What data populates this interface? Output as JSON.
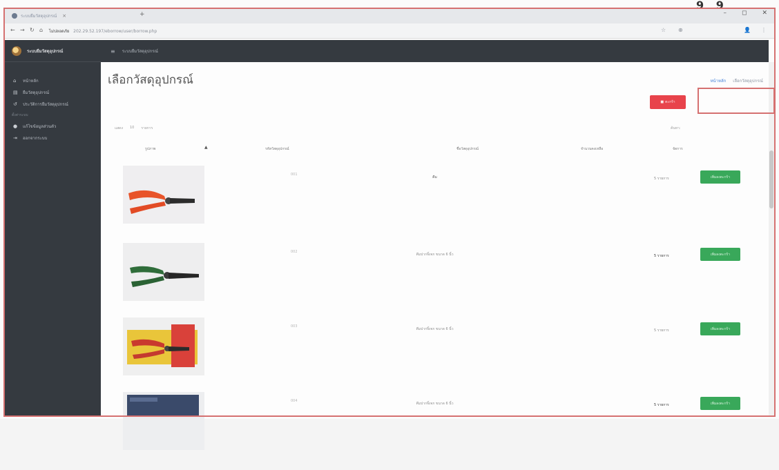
{
  "browser": {
    "tab_title": "ระบบยืมวัสดุอุปกรณ์",
    "tab_close": "×",
    "new_tab": "+",
    "window_controls": {
      "minimize": "–",
      "restore": "◻",
      "close": "✕"
    },
    "nav_icons": {
      "back": "←",
      "forward": "→",
      "reload": "↻",
      "home": "⌂"
    },
    "security_label": "ไม่ปลอดภัย",
    "url": "202.29.52.197/eborrow/user/borrow.php",
    "ext_icons": [
      "☆",
      "⊕",
      "⋮",
      "👤"
    ],
    "scan_marks": "9 9"
  },
  "sidebar": {
    "app_name": "ระบบยืมวัสดุอุปกรณ์",
    "items": [
      {
        "icon": "home-icon",
        "glyph": "⌂",
        "label": "หน้าหลัก"
      },
      {
        "icon": "list-icon",
        "glyph": "▤",
        "label": "ยืมวัสดุอุปกรณ์"
      },
      {
        "icon": "history-icon",
        "glyph": "↺",
        "label": "ประวัติการยืมวัสดุอุปกรณ์"
      }
    ],
    "heading": "ตั้งค่าระบบ",
    "items2": [
      {
        "icon": "user-icon",
        "glyph": "●",
        "label": "แก้ไขข้อมูลส่วนตัว"
      },
      {
        "icon": "logout-icon",
        "glyph": "⇥",
        "label": "ออกจากระบบ"
      }
    ]
  },
  "topbar": {
    "menu_icon": "≡",
    "title": "ระบบยืมวัสดุอุปกรณ์"
  },
  "main": {
    "page_title": "เลือกวัสดุอุปกรณ์",
    "breadcrumb": {
      "home": "หน้าหลัก",
      "current": "เลือกวัสดุอุปกรณ์"
    },
    "cart_button": "ตะกร้า",
    "show_label": "แสดง",
    "entries_value": "10",
    "entries_label": "รายการ",
    "search_label": "ค้นหา:",
    "columns": [
      "รูปภาพ",
      "รหัสวัสดุอุปกรณ์",
      "ชื่อวัสดุอุปกรณ์",
      "จำนวนคงเหลือ",
      "จัดการ"
    ],
    "sort_caret": "▲",
    "rows": [
      {
        "code": "001",
        "name": "คีม",
        "stock": "5 รายการ",
        "action": "เพิ่มลงตะกร้า",
        "image": "pliers-orange"
      },
      {
        "code": "002",
        "name": "คีมปากจิ้งจก ขนาด 6 นิ้ว",
        "stock": "5 รายการ",
        "action": "เพิ่มลงตะกร้า",
        "image": "pliers-green"
      },
      {
        "code": "003",
        "name": "คีมปากจิ้งจก ขนาด 6 นิ้ว",
        "stock": "5 รายการ",
        "action": "เพิ่มลงตะกร้า",
        "image": "pliers-packaged"
      },
      {
        "code": "004",
        "name": "คีมปากจิ้งจก ขนาด 6 นิ้ว",
        "stock": "5 รายการ",
        "action": "เพิ่มลงตะกร้า",
        "image": "pliers-blue"
      }
    ]
  },
  "colors": {
    "sidebar_bg": "#353a40",
    "danger": "#e8434b",
    "success": "#39a85a",
    "link": "#3f7fd8",
    "annotation_red": "#d57070"
  }
}
